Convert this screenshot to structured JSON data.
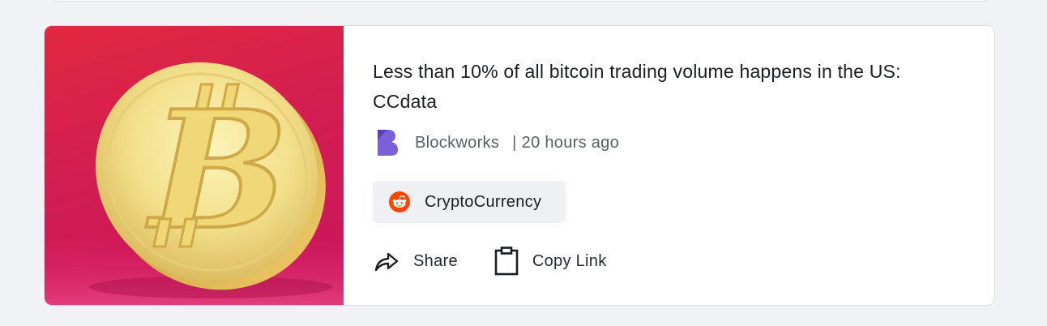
{
  "article": {
    "title": "Less than 10% of all bitcoin trading volume happens in the US: CCdata",
    "source": "Blockworks",
    "time_separator": "|",
    "time": "20 hours ago",
    "thumbnail_icon": "bitcoin-coin-image"
  },
  "tag": {
    "label": "CryptoCurrency",
    "icon": "reddit-icon",
    "color": "#ff4500"
  },
  "actions": {
    "share_label": "Share",
    "copy_label": "Copy Link"
  },
  "colors": {
    "thumbnail_bg": "#d21d52",
    "source_logo": "#7a5fd6"
  }
}
